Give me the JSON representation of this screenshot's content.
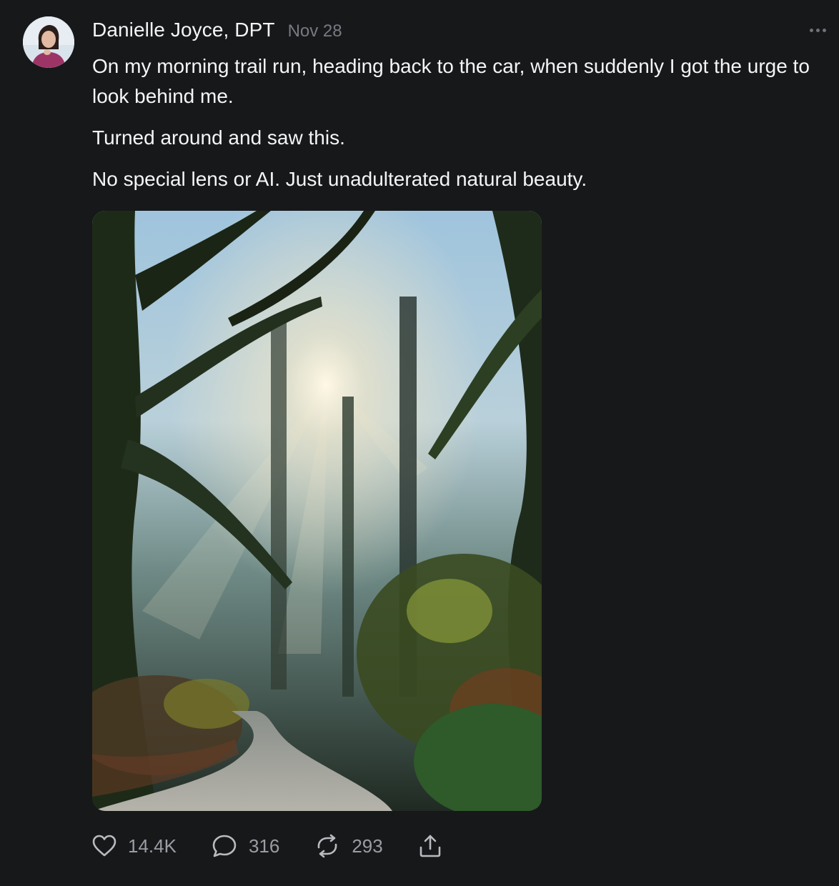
{
  "post": {
    "author": "Danielle Joyce, DPT",
    "timestamp": "Nov 28",
    "more_icon": "more-dots-icon",
    "paragraphs": [
      "On my morning trail run, heading back to the car, when suddenly I got the urge to look behind me.",
      "Turned around and saw this.",
      "No special lens or AI. Just unadulterated natural beauty."
    ],
    "image_icon": "forest-trail-photo"
  },
  "actions": {
    "likes": "14.4K",
    "replies": "316",
    "reposts": "293",
    "like_icon": "heart-icon",
    "reply_icon": "comment-icon",
    "repost_icon": "repost-icon",
    "share_icon": "share-icon"
  },
  "colors": {
    "background": "#17181a",
    "text": "#f3f5f7",
    "muted": "#777a80"
  }
}
